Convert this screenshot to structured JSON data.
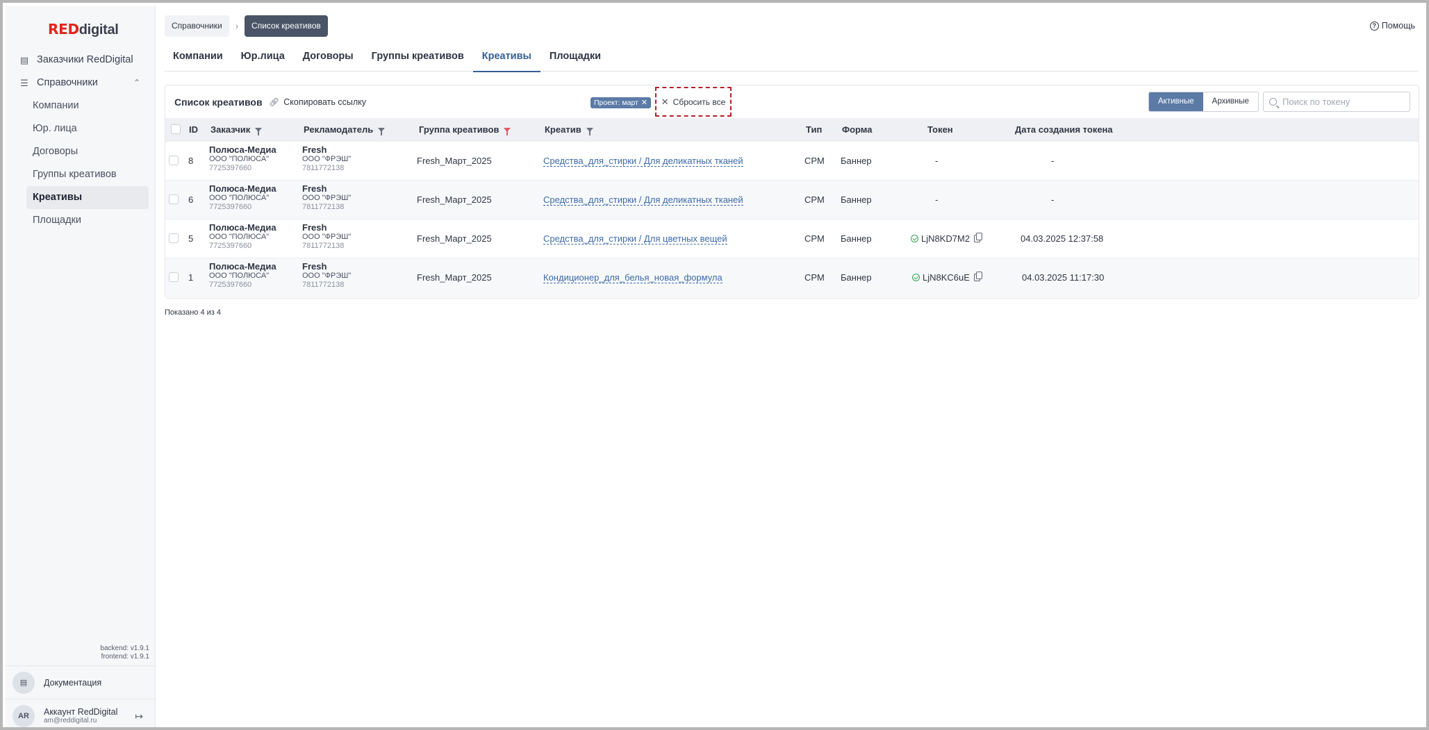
{
  "sidebar": {
    "logo_red": "RED",
    "logo_rest": "digital",
    "items": [
      {
        "label": "Заказчики RedDigital",
        "icon": "id-card-icon"
      },
      {
        "label": "Справочники",
        "icon": "list-icon"
      }
    ],
    "sub_items": [
      {
        "label": "Компании"
      },
      {
        "label": "Юр. лица"
      },
      {
        "label": "Договоры"
      },
      {
        "label": "Группы креативов"
      },
      {
        "label": "Креативы"
      },
      {
        "label": "Площадки"
      }
    ],
    "versions": {
      "backend": "backend: v1.9.1",
      "frontend": "frontend: v1.9.1"
    },
    "docs_label": "Документация",
    "account": {
      "initials": "AR",
      "name": "Аккаунт RedDigital",
      "email": "am@reddigital.ru"
    }
  },
  "breadcrumbs": [
    "Справочники",
    "Список креативов"
  ],
  "help_label": "Помощь",
  "tabs": [
    "Компании",
    "Юр.лица",
    "Договоры",
    "Группы креативов",
    "Креативы",
    "Площадки"
  ],
  "card": {
    "title": "Список креативов",
    "copy_link": "Скопировать ссылку",
    "filter_chip": "Проект: март",
    "reset_all": "Сбросить все",
    "seg": [
      "Активные",
      "Архивные"
    ],
    "search_placeholder": "Поиск по токену"
  },
  "table": {
    "headers": {
      "id": "ID",
      "customer": "Заказчик",
      "advertiser": "Рекламодатель",
      "group": "Группа креативов",
      "creative": "Креатив",
      "type": "Тип",
      "form": "Форма",
      "token": "Токен",
      "token_date": "Дата создания токена"
    },
    "rows": [
      {
        "id": "8",
        "cust_name": "Полюса-Медиа",
        "cust_legal": "ООО \"ПОЛЮСА\"",
        "cust_tin": "7725397660",
        "adv_name": "Fresh",
        "adv_legal": "ООО \"ФРЭШ\"",
        "adv_tin": "7811772138",
        "group": "Fresh_Март_2025",
        "creative": "Средства_для_стирки / Для деликатных тканей",
        "type": "CPM",
        "form": "Баннер",
        "token": "-",
        "date": "-"
      },
      {
        "id": "6",
        "cust_name": "Полюса-Медиа",
        "cust_legal": "ООО \"ПОЛЮСА\"",
        "cust_tin": "7725397660",
        "adv_name": "Fresh",
        "adv_legal": "ООО \"ФРЭШ\"",
        "adv_tin": "7811772138",
        "group": "Fresh_Март_2025",
        "creative": "Средства_для_стирки / Для деликатных тканей",
        "type": "CPM",
        "form": "Баннер",
        "token": "-",
        "date": "-"
      },
      {
        "id": "5",
        "cust_name": "Полюса-Медиа",
        "cust_legal": "ООО \"ПОЛЮСА\"",
        "cust_tin": "7725397660",
        "adv_name": "Fresh",
        "adv_legal": "ООО \"ФРЭШ\"",
        "adv_tin": "7811772138",
        "group": "Fresh_Март_2025",
        "creative": "Средства_для_стирки / Для цветных вещей",
        "type": "CPM",
        "form": "Баннер",
        "token": "LjN8KD7M2",
        "date": "04.03.2025 12:37:58"
      },
      {
        "id": "1",
        "cust_name": "Полюса-Медиа",
        "cust_legal": "ООО \"ПОЛЮСА\"",
        "cust_tin": "7725397660",
        "adv_name": "Fresh",
        "adv_legal": "ООО \"ФРЭШ\"",
        "adv_tin": "7811772138",
        "group": "Fresh_Март_2025",
        "creative": "Кондиционер_для_белья_новая_формула",
        "type": "CPM",
        "form": "Баннер",
        "token": "LjN8KC6uE",
        "date": "04.03.2025 11:17:30"
      }
    ]
  },
  "shown_text": "Показано 4 из 4",
  "colors": {
    "accent": "#5b7aa6",
    "brand_red": "#e1251b",
    "link": "#3b6aa8",
    "reset_border": "#b5202a",
    "ok_green": "#3aa35b"
  }
}
